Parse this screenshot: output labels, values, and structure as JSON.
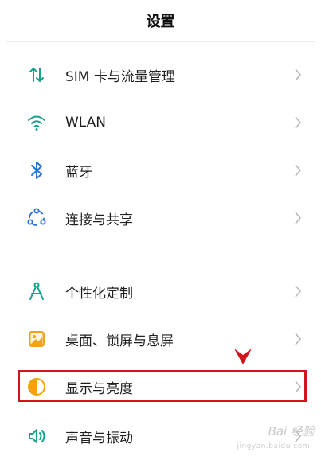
{
  "header": {
    "title": "设置"
  },
  "sections": [
    {
      "items": [
        {
          "label": "SIM 卡与流量管理",
          "icon": "sim-data-icon"
        },
        {
          "label": "WLAN",
          "icon": "wifi-icon"
        },
        {
          "label": "蓝牙",
          "icon": "bluetooth-icon"
        },
        {
          "label": "连接与共享",
          "icon": "connection-share-icon"
        }
      ]
    },
    {
      "items": [
        {
          "label": "个性化定制",
          "icon": "personalization-icon"
        },
        {
          "label": "桌面、锁屏与息屏",
          "icon": "wallpaper-icon"
        },
        {
          "label": "显示与亮度",
          "icon": "display-brightness-icon",
          "highlighted": true
        },
        {
          "label": "声音与振动",
          "icon": "sound-icon"
        }
      ]
    }
  ],
  "watermark": {
    "text": "Bai 经验",
    "sub": "jingyan.baidu.com"
  },
  "colors": {
    "accent": "#17a08a",
    "highlight_box": "#d4141c",
    "display_icon": "#f2a20a",
    "wallpaper_icon": "#f0a21b",
    "chevron": "#b8b8b8"
  }
}
